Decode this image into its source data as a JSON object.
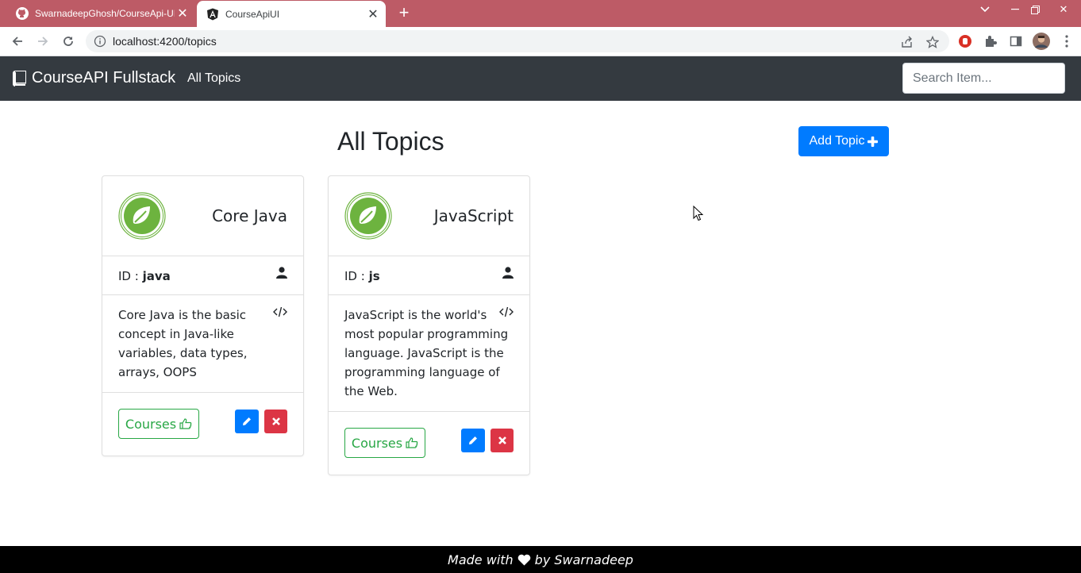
{
  "browser": {
    "tabs": [
      {
        "title": "SwarnadeepGhosh/CourseApi-UI",
        "icon": "github-icon",
        "active": false
      },
      {
        "title": "CourseApiUI",
        "icon": "angular-icon",
        "active": true
      }
    ],
    "url": "localhost:4200/topics"
  },
  "navbar": {
    "brand": "CourseAPI Fullstack",
    "link": "All Topics",
    "search_placeholder": "Search Item..."
  },
  "main": {
    "heading": "All Topics",
    "add_button": "Add Topic"
  },
  "topics": [
    {
      "name": "Core Java",
      "id_label": "ID :",
      "id": "java",
      "description": "Core Java is the basic concept in Java-like variables, data types, arrays, OOPS",
      "courses_label": "Courses"
    },
    {
      "name": "JavaScript",
      "id_label": "ID :",
      "id": "js",
      "description": "JavaScript is the world's most popular programming language. JavaScript is the programming language of the Web.",
      "courses_label": "Courses"
    }
  ],
  "footer": {
    "prefix": "Made with",
    "suffix": "by Swarnadeep"
  },
  "colors": {
    "tab_bar": "#bd5b66",
    "navbar": "#343a40",
    "primary": "#007bff",
    "success": "#28a745",
    "danger": "#dc3545",
    "spring_green": "#6db33f"
  }
}
